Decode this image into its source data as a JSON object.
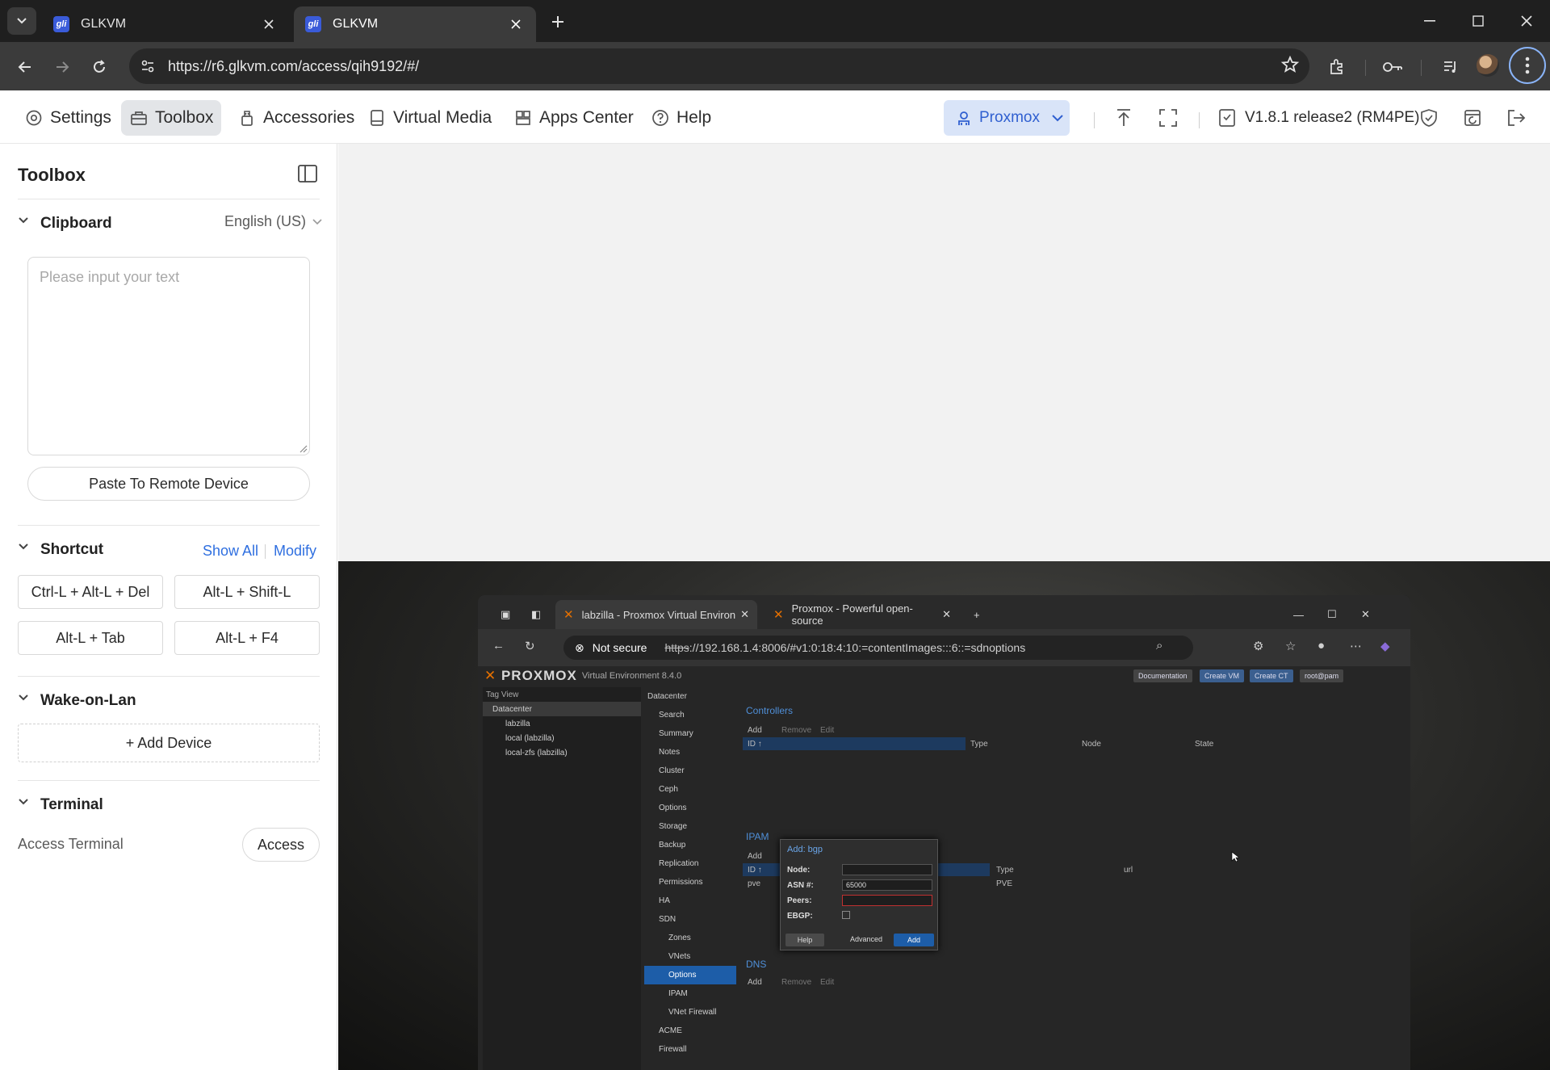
{
  "browser": {
    "tabs": [
      {
        "title": "GLKVM",
        "active": false
      },
      {
        "title": "GLKVM",
        "active": true
      }
    ],
    "url": "https://r6.glkvm.com/access/qih9192/#/"
  },
  "header": {
    "nav": [
      {
        "label": "Settings",
        "icon": "gear-icon",
        "active": false
      },
      {
        "label": "Toolbox",
        "icon": "toolbox-icon",
        "active": true
      },
      {
        "label": "Accessories",
        "icon": "usb-icon",
        "active": false
      },
      {
        "label": "Virtual Media",
        "icon": "disk-icon",
        "active": false
      },
      {
        "label": "Apps Center",
        "icon": "apps-icon",
        "active": false
      },
      {
        "label": "Help",
        "icon": "help-icon",
        "active": false
      }
    ],
    "device_select": "Proxmox",
    "version": "V1.8.1 release2 (RM4PE)",
    "accent": "#2f5fd0"
  },
  "toolbox": {
    "title": "Toolbox",
    "clipboard": {
      "title": "Clipboard",
      "language": "English (US)",
      "placeholder": "Please input your text",
      "paste_button": "Paste To Remote Device"
    },
    "shortcut": {
      "title": "Shortcut",
      "show_all": "Show All",
      "modify": "Modify",
      "keys": [
        "Ctrl-L + Alt-L + Del",
        "Alt-L + Shift-L",
        "Alt-L + Tab",
        "Alt-L + F4"
      ]
    },
    "wol": {
      "title": "Wake-on-Lan",
      "add_device": "+ Add Device"
    },
    "terminal": {
      "title": "Terminal",
      "label": "Access Terminal",
      "button": "Access"
    }
  },
  "remote": {
    "tabs": [
      "labzilla - Proxmox Virtual Environ",
      "Proxmox - Powerful open-source"
    ],
    "not_secure": "Not secure",
    "url_scheme": "https",
    "url_rest": "://192.168.1.4:8006/#v1:0:18:4:10:=contentImages:::6::=sdnoptions",
    "logo": "PROXMOX",
    "pve_version": "Virtual Environment 8.4.0",
    "top_buttons": [
      "Documentation",
      "Create VM",
      "Create CT",
      "root@pam"
    ],
    "tree_header": "Tag View",
    "tree": [
      "Datacenter",
      "labzilla",
      "local (labzilla)",
      "local-zfs (labzilla)"
    ],
    "breadcrumb": "Datacenter",
    "menu": [
      "Search",
      "Summary",
      "Notes",
      "Cluster",
      "Ceph",
      "Options",
      "Storage",
      "Backup",
      "Replication",
      "Permissions",
      "HA",
      "SDN",
      "Zones",
      "VNets",
      "Options",
      "IPAM",
      "VNet Firewall",
      "ACME",
      "Firewall"
    ],
    "controllers_title": "Controllers",
    "controllers_cols": [
      "ID ↑",
      "Type",
      "Node",
      "State"
    ],
    "toolbar": [
      "Add",
      "Remove",
      "Edit"
    ],
    "ipam_title": "IPAM",
    "ipam_cols": [
      "ID ↑",
      "Type",
      "url"
    ],
    "ipam_row": [
      "pve",
      "PVE"
    ],
    "dns_title": "DNS",
    "dialog": {
      "title": "Add: bgp",
      "node_label": "Node:",
      "asn_label": "ASN #:",
      "asn_value": "65000",
      "peers_label": "Peers:",
      "ebgp_label": "EBGP:",
      "help": "Help",
      "advanced": "Advanced",
      "add": "Add"
    }
  }
}
